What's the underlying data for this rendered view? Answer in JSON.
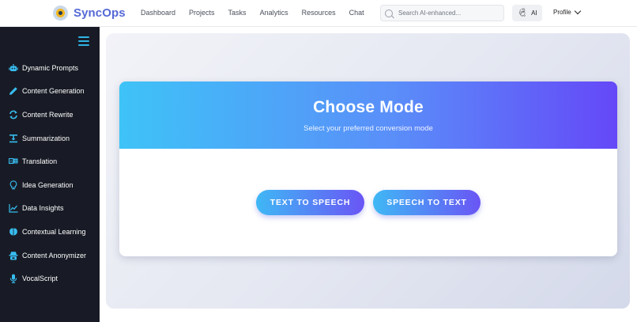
{
  "header": {
    "brand": "SyncOps",
    "nav": [
      "Dashboard",
      "Projects",
      "Tasks",
      "Analytics",
      "Resources",
      "Chat"
    ],
    "search_placeholder": "Search AI-enhanced...",
    "ai_label": "AI",
    "profile_label": "Profile"
  },
  "sidebar": {
    "items": [
      {
        "label": "Dynamic Prompts",
        "icon": "robot-icon"
      },
      {
        "label": "Content Generation",
        "icon": "pen-icon"
      },
      {
        "label": "Content Rewrite",
        "icon": "refresh-icon"
      },
      {
        "label": "Summarization",
        "icon": "summarize-icon"
      },
      {
        "label": "Translation",
        "icon": "translate-icon"
      },
      {
        "label": "Idea Generation",
        "icon": "lightbulb-icon"
      },
      {
        "label": "Data Insights",
        "icon": "chart-line-icon"
      },
      {
        "label": "Contextual Learning",
        "icon": "brain-icon"
      },
      {
        "label": "Content Anonymizer",
        "icon": "incognito-icon"
      },
      {
        "label": "VocalScript",
        "icon": "microphone-icon"
      }
    ]
  },
  "main": {
    "title": "Choose Mode",
    "subtitle": "Select your preferred conversion mode",
    "buttons": [
      "TEXT TO SPEECH",
      "SPEECH TO TEXT"
    ]
  },
  "colors": {
    "brand": "#5569d6",
    "sidebar_bg": "#181b25",
    "accent_icon": "#38bdf0",
    "gradient_start": "#3ec3f7",
    "gradient_end": "#6548f8"
  }
}
